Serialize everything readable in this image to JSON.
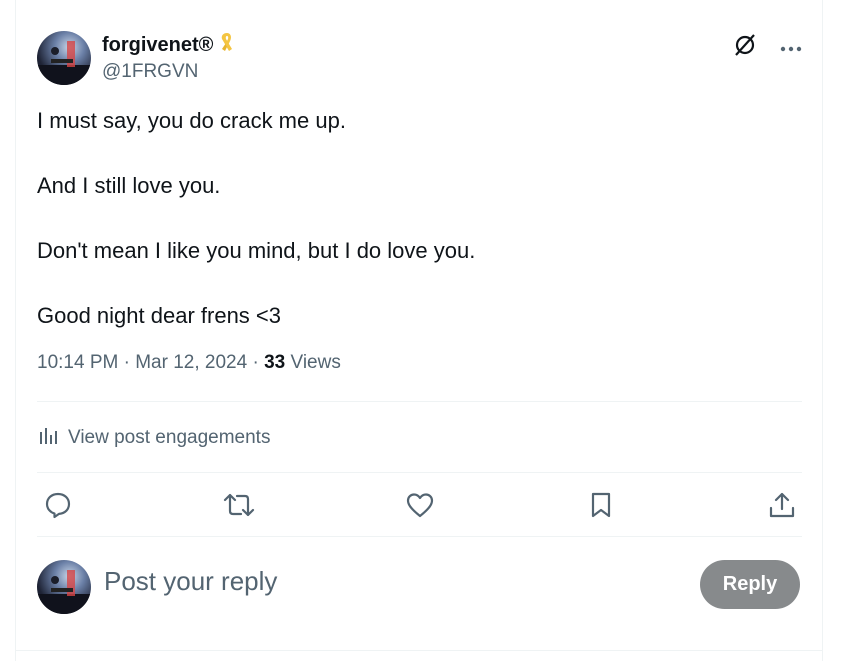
{
  "author": {
    "name": "forgivenet®",
    "handle": "@1FRGVN"
  },
  "post": {
    "lines": [
      "I must say, you do crack me up.",
      "And I still love you.",
      "Don't mean I like you mind, but I do love you.",
      "Good night dear frens <3"
    ],
    "time": "10:14 PM",
    "date": "Mar 12, 2024",
    "separator": "·",
    "views_count": "33",
    "views_label": "Views"
  },
  "engagements_label": "View post engagements",
  "reply": {
    "placeholder": "Post your reply",
    "button_label": "Reply"
  },
  "colors": {
    "text": "#0f1419",
    "muted": "#536471",
    "divider": "#eff3f4",
    "reply_button": "#878a8c",
    "ribbon": "#f4c542"
  },
  "icons": [
    "grok-icon",
    "more-icon",
    "analytics-icon",
    "reply-icon",
    "repost-icon",
    "like-icon",
    "bookmark-icon",
    "share-icon",
    "ribbon-icon"
  ]
}
